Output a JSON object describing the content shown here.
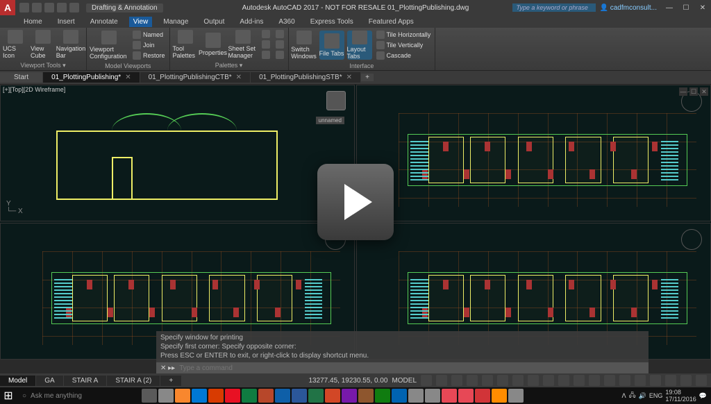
{
  "titlebar": {
    "logo": "A",
    "workspace": "Drafting & Annotation",
    "title": "Autodesk AutoCAD 2017 - NOT FOR RESALE   01_PlottingPublishing.dwg",
    "search_placeholder": "Type a keyword or phrase",
    "user": "cadfmconsult...",
    "min": "—",
    "max": "☐",
    "close": "✕"
  },
  "menu": [
    "Home",
    "Insert",
    "Annotate",
    "View",
    "Manage",
    "Output",
    "Add-ins",
    "A360",
    "Express Tools",
    "Featured Apps"
  ],
  "menu_active": "View",
  "ribbon": {
    "g0": {
      "label": "Viewport Tools ▾",
      "b": [
        "UCS Icon",
        "View Cube",
        "Navigation Bar"
      ]
    },
    "g1": {
      "label": "Model Viewports",
      "cfg": "Viewport Configuration",
      "r": [
        "Named",
        "Join",
        "Restore"
      ]
    },
    "g2": {
      "label": "Palettes ▾",
      "b": [
        "Tool Palettes",
        "Properties",
        "Sheet Set Manager"
      ]
    },
    "g3": {
      "label": "",
      "b": [
        "Switch Windows",
        "File Tabs",
        "Layout Tabs"
      ]
    },
    "g4": {
      "label": "Interface",
      "r": [
        "Tile Horizontally",
        "Tile Vertically",
        "Cascade"
      ]
    }
  },
  "tabs": {
    "start": "Start",
    "t": [
      "01_PlottingPublishing*",
      "01_PlottingPublishingCTB*",
      "01_PlottingPublishingSTB*"
    ],
    "plus": "+"
  },
  "viewport": {
    "label": "[+][Top][2D Wireframe]",
    "unnamed": "unnamed"
  },
  "cmd": {
    "h0": "Specify window for printing",
    "h1": "Specify first corner: Specify opposite corner:",
    "h2": "Press ESC or ENTER to exit, or right-click to display shortcut menu.",
    "prompt": "✕ ▸▸",
    "placeholder": "Type a command"
  },
  "layouts": [
    "Model",
    "GA",
    "STAIR A",
    "STAIR A (2)"
  ],
  "status": {
    "coords": "13277.45, 19230.55, 0.00",
    "space": "MODEL"
  },
  "taskbar": {
    "search": "Ask me anything",
    "lang": "ENG",
    "time": "19:08",
    "date": "17/11/2016"
  },
  "appcolors": [
    "#5a5a5a",
    "#888",
    "#f8872e",
    "#0078d4",
    "#d83b01",
    "#e81123",
    "#0f7c41",
    "#b7472a",
    "#0e5fa8",
    "#2b579a",
    "#217346",
    "#d24726",
    "#7719aa",
    "#8e562e",
    "#107c10",
    "#0063b1",
    "#888",
    "#888",
    "#e74856",
    "#e74856",
    "#d13438",
    "#ff8c00",
    "#888"
  ]
}
